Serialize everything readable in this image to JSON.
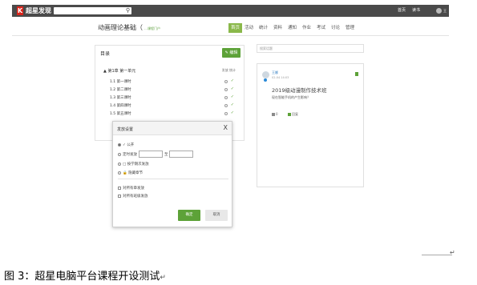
{
  "header": {
    "logo_letter": "K",
    "brand": "超星发现",
    "search_icon": "search-icon",
    "nav": [
      "首页",
      "读书"
    ],
    "user_name": "王娜 ▾"
  },
  "course": {
    "title": "动画理论基础（",
    "subtitle": "…课程门户"
  },
  "tabs": [
    {
      "label": "首页",
      "active": true
    },
    {
      "label": "活动",
      "active": false
    },
    {
      "label": "统计",
      "active": false
    },
    {
      "label": "资料",
      "active": false
    },
    {
      "label": "通知",
      "active": false
    },
    {
      "label": "作业",
      "active": false
    },
    {
      "label": "考试",
      "active": false
    },
    {
      "label": "讨论",
      "active": false
    },
    {
      "label": "管理",
      "active": false
    }
  ],
  "catalog": {
    "title": "目录",
    "edit_label": "编辑",
    "chapter": "第1章 第一单元",
    "chapter_actions": "发放  统计",
    "lessons": [
      "1.1 第一课时",
      "1.2 第二课时",
      "1.3 第三课时",
      "1.4 第四课时",
      "1.5 第五课时"
    ]
  },
  "right": {
    "search_placeholder": "搜索话题",
    "card": {
      "author": "王娜",
      "date": "02-04 14:03",
      "title": "2019级动漫制作技术班",
      "text": "现在智能手机的产生影响？",
      "like": "0",
      "reply": "回复"
    }
  },
  "modal": {
    "title": "发放设置",
    "close": "X",
    "opt_public": "✓ 公开",
    "opt_timed": "定时发放",
    "timed_to": "至",
    "opt_prev": "□ 按学期次发放",
    "opt_hide": "🔒 隐藏章节",
    "chk_all": "对所有章发放",
    "chk_class": "对所有班级发放",
    "ok": "确定",
    "cancel": "取消"
  },
  "caption": "图 3：超星电脑平台课程开设测试",
  "colors": {
    "accent": "#5da238",
    "topbar": "#4a4a4a",
    "brand_red": "#d9251c"
  }
}
